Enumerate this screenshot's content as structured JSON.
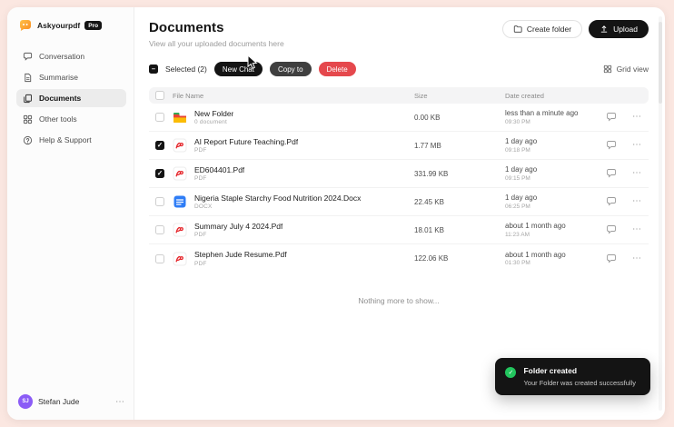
{
  "app": {
    "brand": "Askyourpdf",
    "badge": "Pro"
  },
  "colors": {
    "background_pink": "#fbe7e1",
    "button_dark": "#141414",
    "delete_red": "#e5484d",
    "toast_green": "#22c55e",
    "brand_orange": "#f98a1f",
    "avatar_purple": "#8b5cf6"
  },
  "icons": {
    "more": "⋯",
    "check": "✓",
    "dash": "–"
  },
  "sidebar": {
    "items": [
      {
        "label": "Conversation",
        "icon": "chat-icon"
      },
      {
        "label": "Summarise",
        "icon": "document-icon"
      },
      {
        "label": "Documents",
        "icon": "copy-icon"
      },
      {
        "label": "Other tools",
        "icon": "grid-icon"
      },
      {
        "label": "Help & Support",
        "icon": "help-icon"
      }
    ],
    "user": {
      "name": "Stefan Jude",
      "initials": "SJ"
    }
  },
  "header": {
    "title": "Documents",
    "subtitle": "View all your uploaded documents here",
    "create_folder_label": "Create folder",
    "upload_label": "Upload"
  },
  "toolbar": {
    "selected_label": "Selected (2)",
    "new_chat_label": "New Chat",
    "copy_to_label": "Copy to",
    "delete_label": "Delete",
    "grid_view_label": "Grid view"
  },
  "table": {
    "columns": {
      "name": "File Name",
      "size": "Size",
      "date": "Date created"
    },
    "rows": [
      {
        "name": "New Folder",
        "meta": "0 document",
        "icon": "folder-icon",
        "size": "0.00 KB",
        "date": "less than a minute ago",
        "time": "09:30 PM",
        "checked": false
      },
      {
        "name": "AI Report Future Teaching.Pdf",
        "meta": "PDF",
        "icon": "pdf-file-icon",
        "size": "1.77 MB",
        "date": "1 day ago",
        "time": "09:18 PM",
        "checked": true
      },
      {
        "name": "ED604401.Pdf",
        "meta": "PDF",
        "icon": "pdf-file-icon",
        "size": "331.99 KB",
        "date": "1 day ago",
        "time": "09:15 PM",
        "checked": true
      },
      {
        "name": "Nigeria Staple Starchy Food Nutrition 2024.Docx",
        "meta": "DOCX",
        "icon": "docx-file-icon",
        "size": "22.45 KB",
        "date": "1 day ago",
        "time": "06:25 PM",
        "checked": false
      },
      {
        "name": "Summary July 4 2024.Pdf",
        "meta": "PDF",
        "icon": "pdf-file-icon",
        "size": "18.01 KB",
        "date": "about 1 month ago",
        "time": "11:23 AM",
        "checked": false
      },
      {
        "name": "Stephen Jude Resume.Pdf",
        "meta": "PDF",
        "icon": "pdf-file-icon",
        "size": "122.06 KB",
        "date": "about 1 month ago",
        "time": "01:30 PM",
        "checked": false
      }
    ],
    "empty_text": "Nothing more to show..."
  },
  "toast": {
    "title": "Folder created",
    "message": "Your Folder was created successfully"
  }
}
